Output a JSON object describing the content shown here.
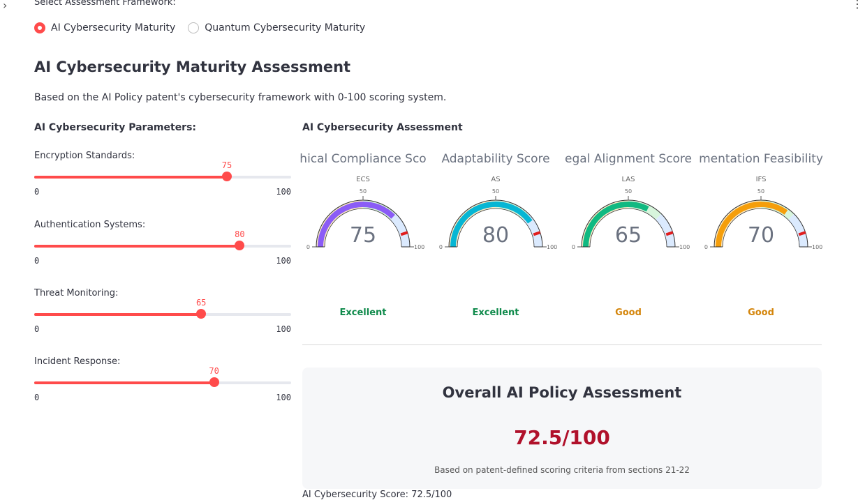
{
  "framework": {
    "label": "Select Assessment Framework:",
    "options": [
      {
        "label": "AI Cybersecurity Maturity",
        "selected": true
      },
      {
        "label": "Quantum Cybersecurity Maturity",
        "selected": false
      }
    ]
  },
  "page": {
    "title": "AI Cybersecurity Maturity Assessment",
    "description": "Based on the AI Policy patent's cybersecurity framework with 0-100 scoring system."
  },
  "parameters": {
    "heading": "AI Cybersecurity Parameters:",
    "sliders": [
      {
        "label": "Encryption Standards:",
        "value": 75,
        "min": 0,
        "max": 100
      },
      {
        "label": "Authentication Systems:",
        "value": 80,
        "min": 0,
        "max": 100
      },
      {
        "label": "Threat Monitoring:",
        "value": 65,
        "min": 0,
        "max": 100
      },
      {
        "label": "Incident Response:",
        "value": 70,
        "min": 0,
        "max": 100
      }
    ]
  },
  "assessment": {
    "heading": "AI Cybersecurity Assessment",
    "gauges": [
      {
        "title": "hical Compliance Sco",
        "subtitle": "ECS",
        "value": 75,
        "mid_tick": "50",
        "min_tick": "0",
        "max_tick": "100",
        "color": "#8b5cf6",
        "status": "Excellent",
        "status_color": "#0f8a4b"
      },
      {
        "title": "Adaptability Score",
        "subtitle": "AS",
        "value": 80,
        "mid_tick": "50",
        "min_tick": "0",
        "max_tick": "100",
        "color": "#06b6d4",
        "status": "Excellent",
        "status_color": "#0f8a4b"
      },
      {
        "title": "egal Alignment Score",
        "subtitle": "LAS",
        "value": 65,
        "mid_tick": "50",
        "min_tick": "0",
        "max_tick": "100",
        "color": "#10b981",
        "status": "Good",
        "status_color": "#d4850b"
      },
      {
        "title": "mentation Feasibility",
        "subtitle": "IFS",
        "value": 70,
        "mid_tick": "50",
        "min_tick": "0",
        "max_tick": "100",
        "color": "#f59e0b",
        "status": "Good",
        "status_color": "#d4850b"
      }
    ]
  },
  "overall": {
    "heading": "Overall AI Policy Assessment",
    "score": "72.5/100",
    "note": "Based on patent-defined scoring criteria from sections 21-22"
  },
  "footer_cutoff": "AI Cybersecurity Score: 72.5/100",
  "icons": {
    "expander": "chevron-right-icon",
    "menu": "kebab-menu-icon"
  }
}
